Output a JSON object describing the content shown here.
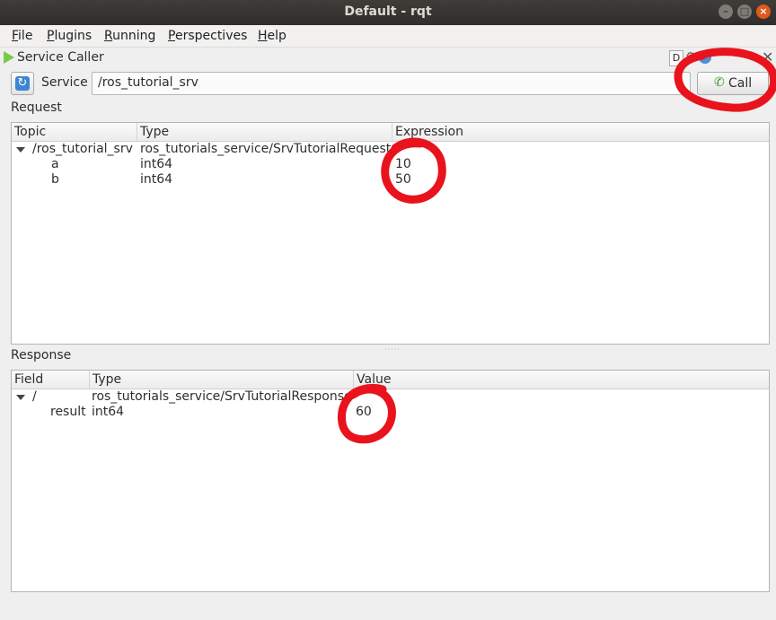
{
  "window": {
    "title": "Default - rqt"
  },
  "menu": [
    {
      "label": "File",
      "key": "F",
      "rest": "ile"
    },
    {
      "label": "Plugins",
      "key": "P",
      "rest": "lugins"
    },
    {
      "label": "Running",
      "key": "R",
      "rest": "unning"
    },
    {
      "label": "Perspectives",
      "key": "P",
      "rest": "erspectives"
    },
    {
      "label": "Help",
      "key": "H",
      "rest": "elp"
    }
  ],
  "plugin": {
    "title": "Service Caller",
    "d_button": "D"
  },
  "service": {
    "label": "Service",
    "value": "/ros_tutorial_srv",
    "call_label": "Call"
  },
  "request": {
    "section_label": "Request",
    "columns": [
      "Topic",
      "Type",
      "Expression"
    ],
    "root": {
      "topic": "/ros_tutorial_srv",
      "type": "ros_tutorials_service/SrvTutorialRequest",
      "expression": ""
    },
    "rows": [
      {
        "topic": "a",
        "type": "int64",
        "expression": "10"
      },
      {
        "topic": "b",
        "type": "int64",
        "expression": "50"
      }
    ]
  },
  "response": {
    "section_label": "Response",
    "columns": [
      "Field",
      "Type",
      "Value"
    ],
    "root": {
      "field": "/",
      "type": "ros_tutorials_service/SrvTutorialResponse",
      "value": ""
    },
    "rows": [
      {
        "field": "result",
        "type": "int64",
        "value": "60"
      }
    ]
  },
  "colors": {
    "annotation": "#e8131c",
    "titlebar": "#3a3935",
    "close_button": "#e2591c",
    "play_icon": "#7ac943"
  }
}
